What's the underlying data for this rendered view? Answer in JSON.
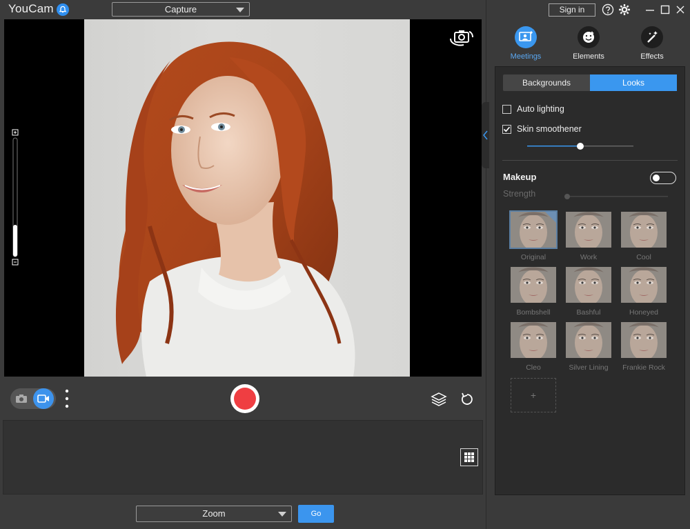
{
  "app": {
    "title": "YouCam",
    "mode": "Capture"
  },
  "header": {
    "sign_in": "Sign in"
  },
  "categories": [
    {
      "label": "Meetings",
      "active": true
    },
    {
      "label": "Elements",
      "active": false
    },
    {
      "label": "Effects",
      "active": false
    }
  ],
  "tabs": {
    "backgrounds": "Backgrounds",
    "looks": "Looks",
    "selected": "Looks"
  },
  "options": {
    "auto_lighting": {
      "label": "Auto lighting",
      "checked": false
    },
    "skin_smoothener": {
      "label": "Skin smoothener",
      "checked": true
    }
  },
  "makeup": {
    "title": "Makeup",
    "enabled": false,
    "strength_label": "Strength",
    "looks": [
      "Original",
      "Work",
      "Cool",
      "Bombshell",
      "Bashful",
      "Honeyed",
      "Cleo",
      "Silver Lining",
      "Frankie Rock"
    ],
    "selected": "Original",
    "add_label": "+"
  },
  "meeting": {
    "app": "Zoom",
    "go": "Go"
  },
  "colors": {
    "accent": "#3a97ef",
    "record": "#ef3e42",
    "background": "#3b3b3b",
    "panel": "#2b2b2b"
  }
}
